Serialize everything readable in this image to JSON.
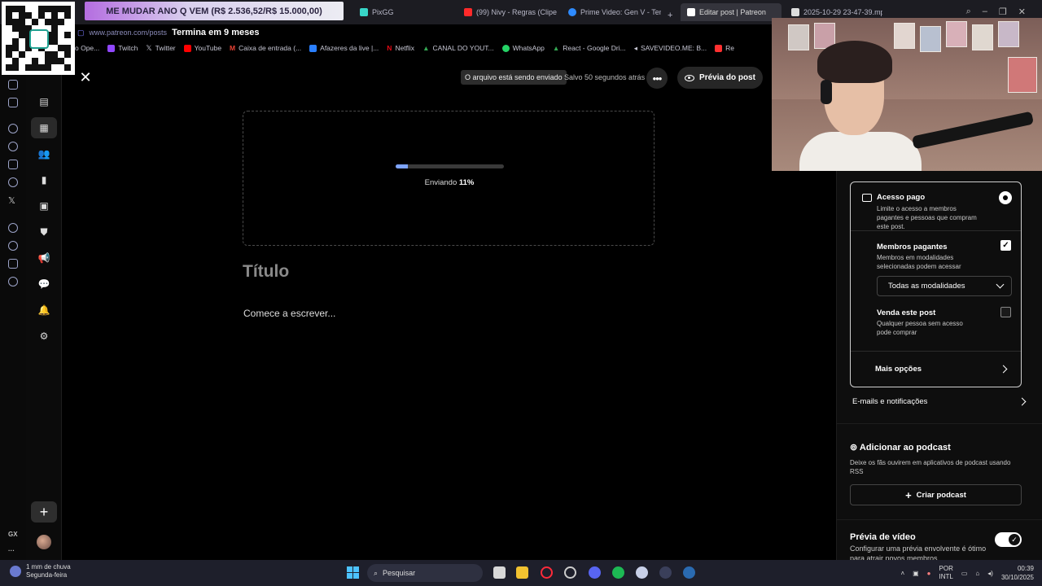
{
  "tabs": [
    {
      "label": "PixGG",
      "color": "#38d6c8"
    },
    {
      "label": "(99) Nivy - Regras (Clipe",
      "color": "#ff2a2a"
    },
    {
      "label": "Prime Video: Gen V - Tem",
      "color": "#2e8bff"
    },
    {
      "label": "Editar post | Patreon",
      "color": "#ffffff",
      "active": true
    },
    {
      "label": "2025-10-29 23-47-39.mp",
      "color": "#dddddd"
    }
  ],
  "new_tab": "+",
  "goal_banner": "ME MUDAR ANO Q VEM (R$ 2.536,52/R$ 15.000,00)",
  "address": {
    "url": "www.patreon.com/posts",
    "ends": "Termina em 9 meses"
  },
  "bookmarks": [
    {
      "label": "o Ope...",
      "color": "#888888"
    },
    {
      "label": "Twitch",
      "color": "#9147ff"
    },
    {
      "label": "Twitter",
      "color": "#ffffff"
    },
    {
      "label": "YouTube",
      "color": "#ff0000"
    },
    {
      "label": "Caixa de entrada (...",
      "color": "#ea4335"
    },
    {
      "label": "Afazeres da live |...",
      "color": "#2a7fff"
    },
    {
      "label": "Netflix",
      "color": "#e50914"
    },
    {
      "label": "CANAL DO YOUT...",
      "color": "#34a853"
    },
    {
      "label": "WhatsApp",
      "color": "#25d366"
    },
    {
      "label": "React - Google Dri...",
      "color": "#34a853"
    },
    {
      "label": "SAVEVIDEO.ME: B...",
      "color": "#ffffff"
    },
    {
      "label": "Re",
      "color": "#ff3030"
    }
  ],
  "editor": {
    "upload_status": "O arquivo está sendo enviado",
    "saved": "Salvo 50 segundos atrás",
    "more": "•••",
    "preview_button": "Prévia do post",
    "progress_label": "Enviando",
    "progress_value": "11%",
    "progress_fraction": 0.11,
    "title_placeholder": "Título",
    "body_placeholder": "Comece a escrever..."
  },
  "access": {
    "paid_title": "Acesso pago",
    "paid_desc": "Limite o acesso a membros pagantes e pessoas que compram este post.",
    "members_title": "Membros pagantes",
    "members_desc": "Membros em modalidades selecionadas podem acessar",
    "tier_select": "Todas as modalidades",
    "sell_title": "Venda este post",
    "sell_desc": "Qualquer pessoa sem acesso pode comprar",
    "more_options": "Mais opções"
  },
  "emails_notifications": "E-mails e notificações",
  "podcast": {
    "title": "Adicionar ao podcast",
    "desc": "Deixe os fãs ouvirem em aplicativos de podcast usando RSS",
    "button": "Criar podcast"
  },
  "video_preview": {
    "title": "Prévia de vídeo",
    "desc": "Configurar uma prévia envolvente é ótimo para atrair novos membros"
  },
  "rail1_labels": {
    "gx": "GX",
    "dots": "···"
  },
  "taskbar": {
    "weather_temp": "1 mm de chuva",
    "weather_day": "Segunda-feira",
    "search": "Pesquisar",
    "lang1": "POR",
    "lang2": "INTL",
    "time": "00:39",
    "date": "30/10/2025"
  }
}
